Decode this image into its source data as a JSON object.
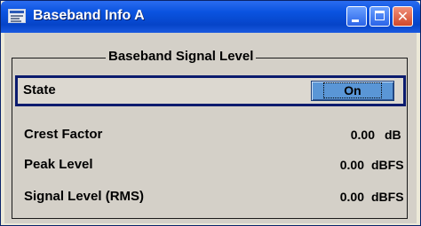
{
  "window": {
    "title": "Baseband Info A",
    "controls": [
      "minimize-icon",
      "maximize-icon",
      "close-icon"
    ]
  },
  "group": {
    "title": "Baseband Signal Level"
  },
  "state": {
    "label": "State",
    "button_label": "On"
  },
  "measurements": [
    {
      "label": "Crest Factor",
      "value": "0.00",
      "unit": "dB"
    },
    {
      "label": "Peak Level",
      "value": "0.00",
      "unit": "dBFS"
    },
    {
      "label": "Signal Level (RMS)",
      "value": "0.00",
      "unit": "dBFS"
    }
  ],
  "colors": {
    "title_bar": "#0a53e0",
    "state_button": "#5a96d6",
    "focus_border": "#0b1b6e"
  }
}
